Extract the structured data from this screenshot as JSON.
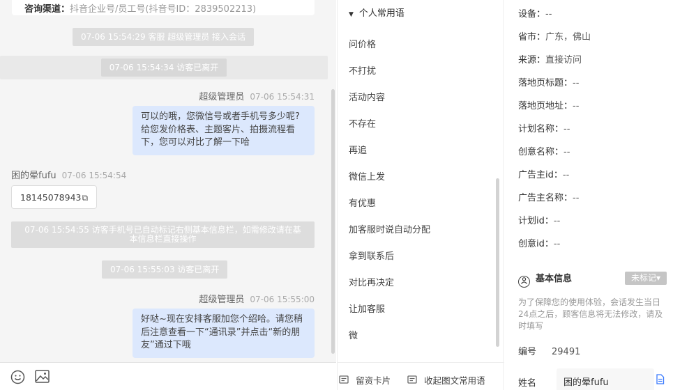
{
  "chat": {
    "top_card": {
      "label": "咨询渠道：",
      "value": "抖音企业号/员工号(抖音号ID：2839502213)"
    },
    "sys1": "07-06 15:54:29 客服 超级管理员 接入会话",
    "sys2": "07-06 15:54:34 访客已离开",
    "msg1": {
      "sender": "超级管理员",
      "time": "07-06 15:54:31",
      "lines": [
        "可以的哦，您微信号或者手机号多少呢?",
        "给您发价格表、主题客片、拍摄流程看",
        "下，您可以对比了解一下哈"
      ]
    },
    "msg2": {
      "sender": "困的晕fufu",
      "time": "07-06 15:54:54",
      "text": "18145078943",
      "copy_icon": "copy-icon"
    },
    "sys3": [
      "07-06 15:54:55 访客手机号已自动标记右侧基本信息栏，如需修改请在基",
      "本信息栏直接操作"
    ],
    "sys4": "07-06 15:55:03 访客已离开",
    "msg3": {
      "sender": "超级管理员",
      "time": "07-06 15:55:00",
      "lines": [
        "好哒~现在安排客服加您个绍哈。请您稍",
        "后注意查看一下“通讯录”并点击“新的朋",
        "友”通过下哦"
      ]
    },
    "toolbar": {
      "emoji_icon": "emoji-icon",
      "image_icon": "image-icon"
    }
  },
  "phrases": {
    "group_title": "个人常用语",
    "items": [
      "问价格",
      "不打扰",
      "活动内容",
      "不存在",
      "再追",
      "微信上发",
      "有优惠",
      "加客服时说自动分配",
      "拿到联系后",
      "对比再决定",
      "让加客服",
      "微"
    ],
    "footer": {
      "card": "留资卡片",
      "collapse": "收起图文常用语"
    }
  },
  "info": {
    "rows": [
      {
        "label": "设备：",
        "value": "--"
      },
      {
        "label": "省市：",
        "value": "广东，佛山"
      },
      {
        "label": "来源：",
        "value": "直接访问"
      },
      {
        "label": "落地页标题：",
        "value": "--"
      },
      {
        "label": "落地页地址：",
        "value": "--"
      },
      {
        "label": "计划名称：",
        "value": "--"
      },
      {
        "label": "创意名称：",
        "value": "--"
      },
      {
        "label": "广告主id：",
        "value": "--"
      },
      {
        "label": "广告主名称：",
        "value": "--"
      },
      {
        "label": "计划id：",
        "value": "--"
      },
      {
        "label": "创意id：",
        "value": "--"
      }
    ],
    "section_title": "基本信息",
    "mark_button": "未标记▾",
    "note": "为了保障您的使用体验，会话发生当日24点之后，顾客信息将无法修改，请及时填写",
    "number_label": "编号",
    "number_value": "29491",
    "name_label": "姓名",
    "name_value": "困的晕fufu"
  }
}
